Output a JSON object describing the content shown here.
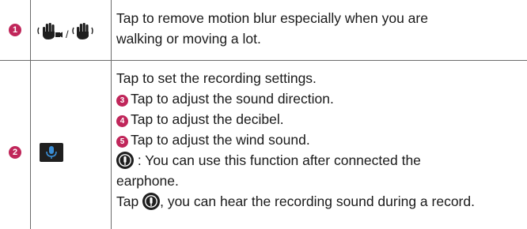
{
  "rows": [
    {
      "number": "1",
      "icon": "steady-hand-icons",
      "separator": "/",
      "description_lines": [
        "Tap to remove motion blur especially when you are",
        "walking or moving a lot."
      ]
    },
    {
      "number": "2",
      "icon": "microphone-icon",
      "description_lines": [
        "Tap to set the recording settings."
      ],
      "sub_items": [
        {
          "number": "3",
          "text": "Tap to adjust the sound direction."
        },
        {
          "number": "4",
          "text": "Tap to adjust the decibel."
        },
        {
          "number": "5",
          "text": "Tap to adjust the wind sound."
        }
      ],
      "earphone_note_line1": ": You can use this function after connected the",
      "earphone_note_line2": "earphone.",
      "tap_prefix": "Tap",
      "tap_suffix": ", you can hear the recording sound during a record."
    }
  ],
  "colors": {
    "badge": "#c0265a",
    "border": "#6b6b6b",
    "icon_bg": "#1f1f1f",
    "mic_blue": "#3a8ed6"
  }
}
